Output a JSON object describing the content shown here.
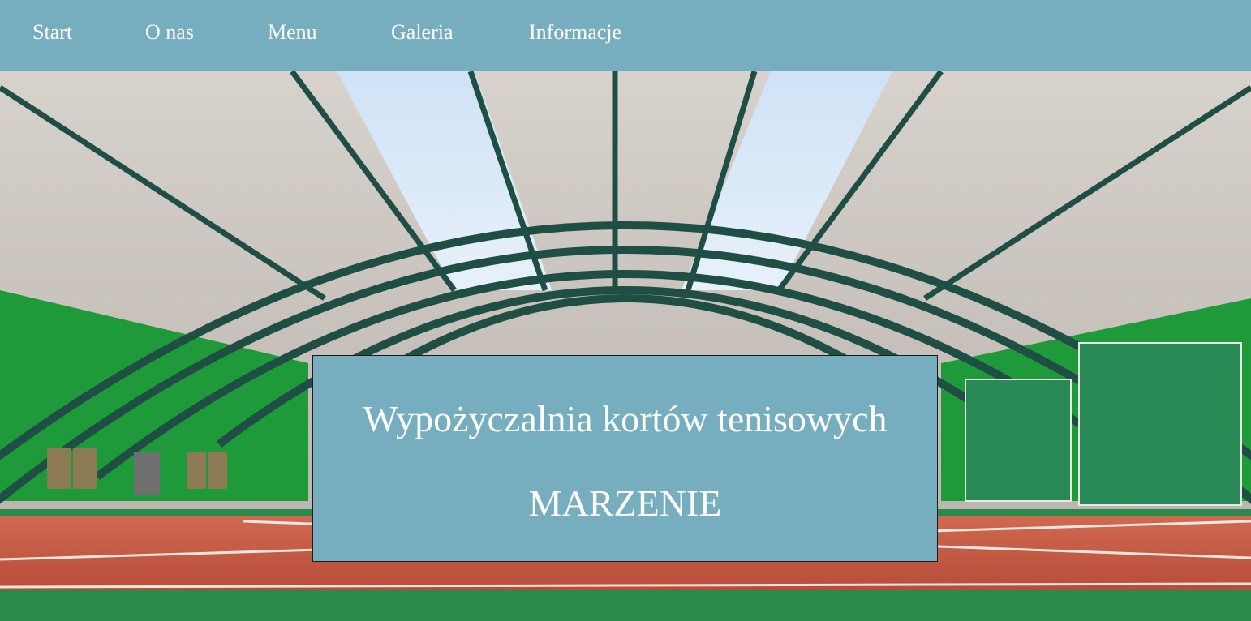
{
  "nav": {
    "items": [
      {
        "label": "Start"
      },
      {
        "label": "O nas"
      },
      {
        "label": "Menu"
      },
      {
        "label": "Galeria"
      },
      {
        "label": "Informacje"
      }
    ]
  },
  "hero": {
    "image": "indoor-tennis-hall",
    "title": "Wypożyczalnia kortów tenisowych",
    "name": "MARZENIE"
  },
  "colors": {
    "accent": "#76aec0",
    "text": "#ffffff",
    "court_clay": "#c85a45",
    "court_green": "#2a8a4a"
  }
}
